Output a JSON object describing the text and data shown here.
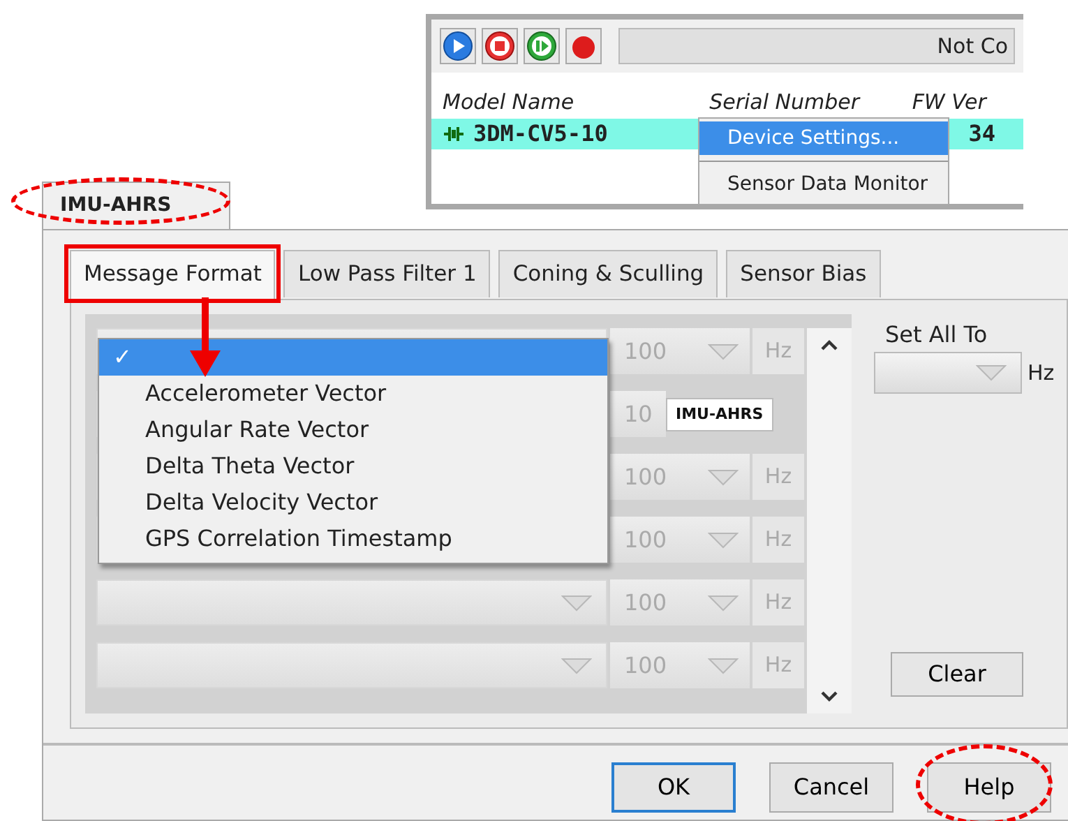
{
  "device_window": {
    "toolbar_buttons": [
      {
        "kind": "play"
      },
      {
        "kind": "stop"
      },
      {
        "kind": "resume"
      },
      {
        "kind": "record"
      }
    ],
    "status": "Not Co",
    "columns": [
      "Model Name",
      "Serial Number",
      "FW Ver"
    ],
    "rows": [
      {
        "model_name": "3DM-CV5-10",
        "fw_ver": "34",
        "selected": true
      }
    ],
    "context_menu": [
      {
        "label": "Device Settings...",
        "selected": true
      },
      {
        "label": "Sensor Data Monitor",
        "selected": false
      }
    ]
  },
  "dialog": {
    "outer_tab": {
      "label": "IMU-AHRS",
      "annotated": true
    },
    "tabs": [
      {
        "label": "Message Format",
        "selected": true,
        "annotated": true
      },
      {
        "label": "Low Pass Filter 1",
        "selected": false,
        "annotated": false
      },
      {
        "label": "Coning & Sculling",
        "selected": false,
        "annotated": false
      },
      {
        "label": "Sensor Bias",
        "selected": false,
        "annotated": false
      }
    ],
    "rows": [
      {
        "rate": "100",
        "unit": "Hz"
      },
      {
        "rate": "10",
        "stray_label": "IMU-AHRS"
      },
      {
        "rate": "100",
        "unit": "Hz"
      },
      {
        "rate": "100",
        "unit": "Hz"
      },
      {
        "rate": "100",
        "unit": "Hz"
      },
      {
        "rate": "100",
        "unit": "Hz"
      }
    ],
    "dropdown": [
      {
        "label": "✓",
        "selected": true
      },
      {
        "label": "Accelerometer Vector",
        "selected": false
      },
      {
        "label": "Angular Rate Vector",
        "selected": false
      },
      {
        "label": "Delta Theta Vector",
        "selected": false
      },
      {
        "label": "Delta Velocity Vector",
        "selected": false
      },
      {
        "label": "GPS Correlation Timestamp",
        "selected": false
      }
    ],
    "set_all_to": {
      "label": "Set All To",
      "unit": "Hz"
    },
    "clear": "Clear",
    "buttons": [
      {
        "label": "OK",
        "default": true,
        "annotated": false
      },
      {
        "label": "Cancel",
        "default": false,
        "annotated": false
      },
      {
        "label": "Help",
        "default": false,
        "annotated": true
      }
    ]
  }
}
